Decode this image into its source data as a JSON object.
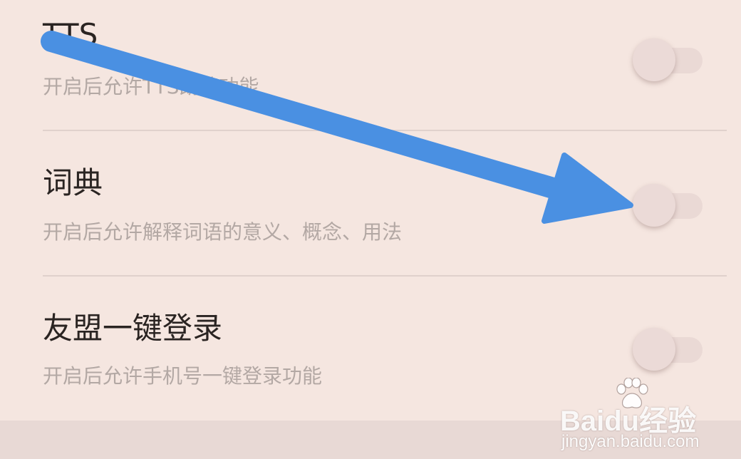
{
  "settings": {
    "items": [
      {
        "title": "TTS",
        "description": "开启后允许TTS朗读功能",
        "enabled": false
      },
      {
        "title": "词典",
        "description": "开启后允许解释词语的意义、概念、用法",
        "enabled": false
      },
      {
        "title": "友盟一键登录",
        "description": "开启后允许手机号一键登录功能",
        "enabled": false
      }
    ]
  },
  "watermark": {
    "brand": "Bai",
    "brand_du": "du",
    "brand_suffix": "经验",
    "url": "jingyan.baidu.com"
  },
  "colors": {
    "background": "#f5e6e0",
    "title_text": "#2a2422",
    "description_text": "#b3a8a4",
    "annotation_arrow": "#4a90e2"
  }
}
